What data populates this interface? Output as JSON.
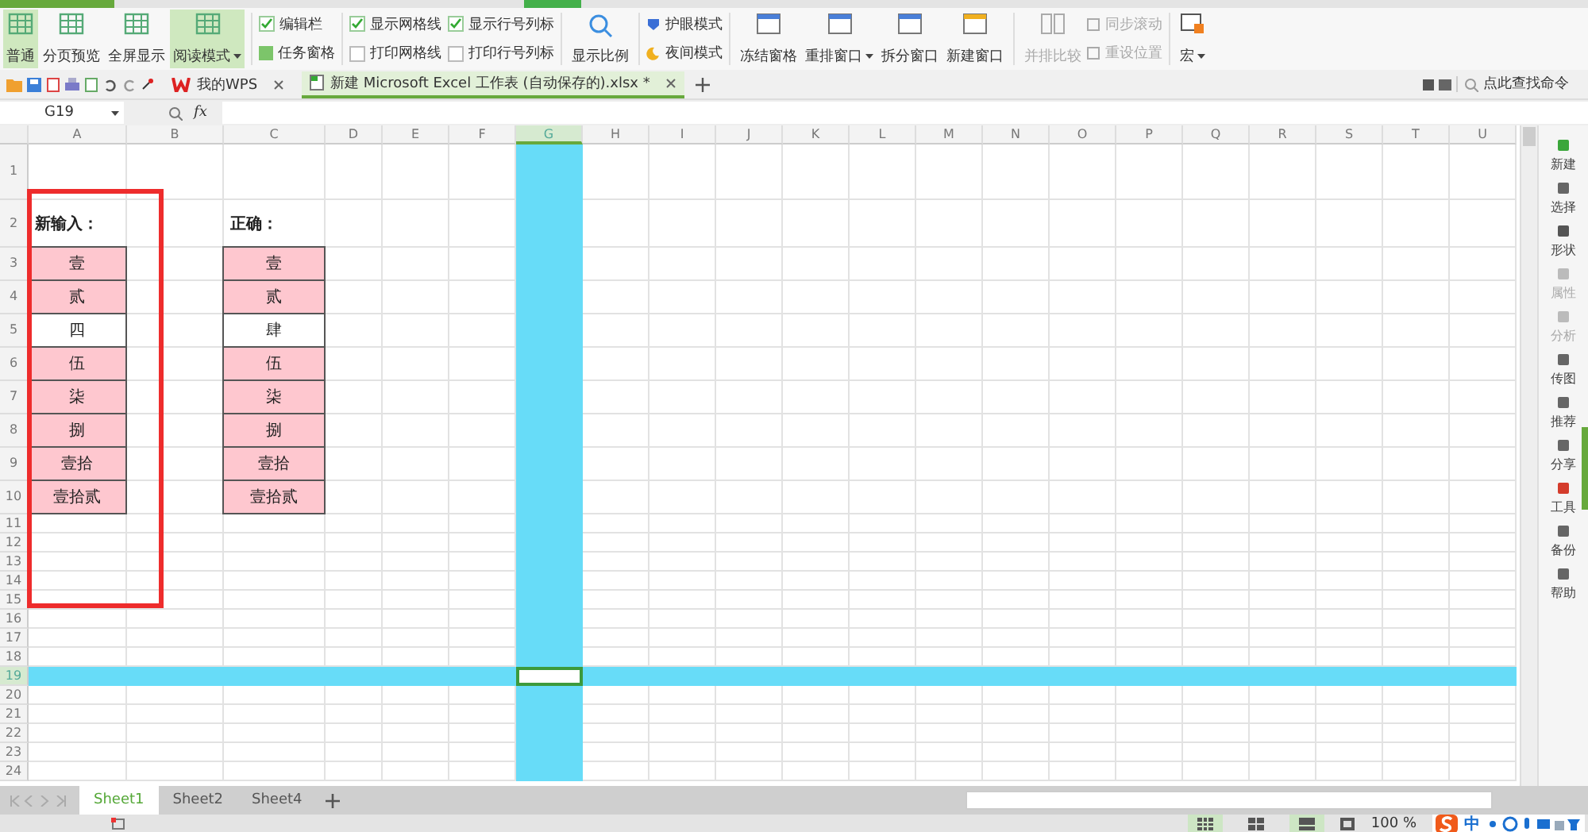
{
  "ribbon": {
    "view_modes": [
      {
        "label": "普通",
        "selected": true,
        "dropdown": false
      },
      {
        "label": "分页预览",
        "selected": false,
        "dropdown": false
      },
      {
        "label": "全屏显示",
        "selected": false,
        "dropdown": false
      },
      {
        "label": "阅读模式",
        "selected": true,
        "dropdown": true
      }
    ],
    "panel_toggles": [
      {
        "label": "编辑栏",
        "kind": "checkbox",
        "checked": true
      },
      {
        "label": "任务窗格",
        "kind": "pane",
        "checked": true
      }
    ],
    "display_checks": [
      {
        "label": "显示网格线",
        "checked": true
      },
      {
        "label": "显示行号列标",
        "checked": true
      },
      {
        "label": "打印网格线",
        "checked": false
      },
      {
        "label": "打印行号列标",
        "checked": false
      }
    ],
    "zoom_button": "显示比例",
    "eye_modes": [
      "护眼模式",
      "夜间模式"
    ],
    "window_buttons": [
      {
        "label": "冻结窗格",
        "dropdown": false
      },
      {
        "label": "重排窗口",
        "dropdown": true
      },
      {
        "label": "拆分窗口",
        "dropdown": false
      },
      {
        "label": "新建窗口",
        "dropdown": false
      }
    ],
    "compare": {
      "label": "并排比较",
      "disabled": true
    },
    "compare_options": [
      {
        "label": "同步滚动",
        "disabled": true
      },
      {
        "label": "重设位置",
        "disabled": true
      }
    ],
    "macro": {
      "label": "宏",
      "dropdown": true
    }
  },
  "doc_tabs": [
    {
      "label": "我的WPS",
      "selected": false
    },
    {
      "label": "新建 Microsoft Excel 工作表 (自动保存的).xlsx *",
      "selected": true
    }
  ],
  "command_search": {
    "placeholder": "点此查找命令"
  },
  "formula_bar": {
    "name_box": "G19",
    "fx": "fx"
  },
  "sheet": {
    "columns": [
      {
        "label": "A",
        "selected": false
      },
      {
        "label": "B",
        "selected": false
      },
      {
        "label": "C",
        "selected": false
      },
      {
        "label": "D",
        "selected": false
      },
      {
        "label": "E",
        "selected": false
      },
      {
        "label": "F",
        "selected": false
      },
      {
        "label": "G",
        "selected": true
      },
      {
        "label": "H",
        "selected": false
      },
      {
        "label": "I",
        "selected": false
      },
      {
        "label": "J",
        "selected": false
      },
      {
        "label": "K",
        "selected": false
      },
      {
        "label": "L",
        "selected": false
      },
      {
        "label": "M",
        "selected": false
      },
      {
        "label": "N",
        "selected": false
      },
      {
        "label": "O",
        "selected": false
      },
      {
        "label": "P",
        "selected": false
      },
      {
        "label": "Q",
        "selected": false
      },
      {
        "label": "R",
        "selected": false
      },
      {
        "label": "S",
        "selected": false
      },
      {
        "label": "T",
        "selected": false
      },
      {
        "label": "U",
        "selected": false
      }
    ],
    "rows": [
      {
        "label": "1",
        "selected": false
      },
      {
        "label": "2",
        "selected": false
      },
      {
        "label": "3",
        "selected": false
      },
      {
        "label": "4",
        "selected": false
      },
      {
        "label": "5",
        "selected": false
      },
      {
        "label": "6",
        "selected": false
      },
      {
        "label": "7",
        "selected": false
      },
      {
        "label": "8",
        "selected": false
      },
      {
        "label": "9",
        "selected": false
      },
      {
        "label": "10",
        "selected": false
      },
      {
        "label": "11",
        "selected": false
      },
      {
        "label": "12",
        "selected": false
      },
      {
        "label": "13",
        "selected": false
      },
      {
        "label": "14",
        "selected": false
      },
      {
        "label": "15",
        "selected": false
      },
      {
        "label": "16",
        "selected": false
      },
      {
        "label": "17",
        "selected": false
      },
      {
        "label": "18",
        "selected": false
      },
      {
        "label": "19",
        "selected": true
      },
      {
        "label": "20",
        "selected": false
      },
      {
        "label": "21",
        "selected": false
      },
      {
        "label": "22",
        "selected": false
      },
      {
        "label": "23",
        "selected": false
      },
      {
        "label": "24",
        "selected": false
      }
    ],
    "left_block": {
      "heading": "新输入：",
      "cells": [
        {
          "text": "壹",
          "filled": true
        },
        {
          "text": "贰",
          "filled": true
        },
        {
          "text": "四",
          "filled": false
        },
        {
          "text": "伍",
          "filled": true
        },
        {
          "text": "柒",
          "filled": true
        },
        {
          "text": "捌",
          "filled": true
        },
        {
          "text": "壹拾",
          "filled": true
        },
        {
          "text": "壹拾贰",
          "filled": true
        }
      ]
    },
    "right_block": {
      "heading": "正确：",
      "cells": [
        {
          "text": "壹",
          "filled": true
        },
        {
          "text": "贰",
          "filled": true
        },
        {
          "text": "肆",
          "filled": false
        },
        {
          "text": "伍",
          "filled": true
        },
        {
          "text": "柒",
          "filled": true
        },
        {
          "text": "捌",
          "filled": true
        },
        {
          "text": "壹拾",
          "filled": true
        },
        {
          "text": "壹拾贰",
          "filled": true
        }
      ]
    },
    "annotation_frame": true
  },
  "sidebar": [
    {
      "label": "新建",
      "disabled": false
    },
    {
      "label": "选择",
      "disabled": false
    },
    {
      "label": "形状",
      "disabled": false
    },
    {
      "label": "属性",
      "disabled": true
    },
    {
      "label": "分析",
      "disabled": true
    },
    {
      "label": "传图",
      "disabled": false
    },
    {
      "label": "推荐",
      "disabled": false
    },
    {
      "label": "分享",
      "disabled": false
    },
    {
      "label": "工具",
      "disabled": false
    },
    {
      "label": "备份",
      "disabled": false
    },
    {
      "label": "帮助",
      "disabled": false
    }
  ],
  "sheet_tabs": [
    {
      "label": "Sheet1",
      "selected": true
    },
    {
      "label": "Sheet2",
      "selected": false
    },
    {
      "label": "Sheet4",
      "selected": false
    }
  ],
  "status_bar": {
    "zoom_level": "100 %",
    "ime_mode": "中"
  }
}
